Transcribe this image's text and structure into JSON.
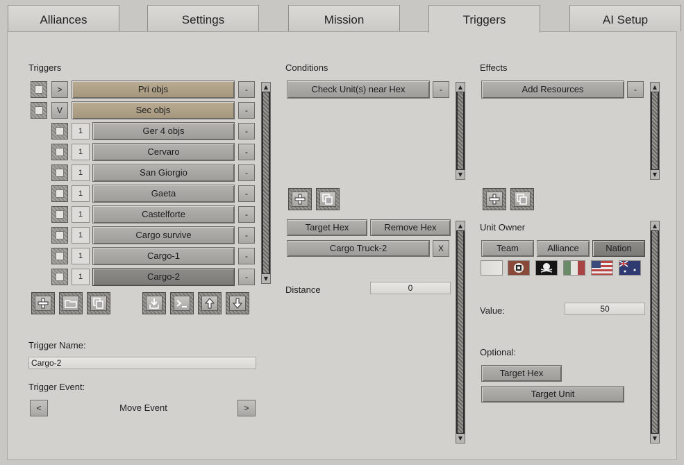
{
  "tabs": [
    "Alliances",
    "Settings",
    "Mission",
    "Triggers",
    "AI Setup"
  ],
  "triggers": {
    "label": "Triggers",
    "rows": [
      {
        "toggle": ">",
        "name": "Pri objs",
        "remove": "-"
      },
      {
        "toggle": "V",
        "name": "Sec objs",
        "remove": "-"
      },
      {
        "num": "1",
        "name": "Ger 4 objs",
        "remove": "-"
      },
      {
        "num": "1",
        "name": "Cervaro",
        "remove": "-"
      },
      {
        "num": "1",
        "name": "San Giorgio",
        "remove": "-"
      },
      {
        "num": "1",
        "name": "Gaeta",
        "remove": "-"
      },
      {
        "num": "1",
        "name": "Castelforte",
        "remove": "-"
      },
      {
        "num": "1",
        "name": "Cargo survive",
        "remove": "-"
      },
      {
        "num": "1",
        "name": "Cargo-1",
        "remove": "-"
      },
      {
        "num": "1",
        "name": "Cargo-2",
        "remove": "-"
      }
    ],
    "name_label": "Trigger Name:",
    "name_value": "Cargo-2",
    "event_label": "Trigger Event:",
    "event_prev": "<",
    "event_value": "Move Event",
    "event_next": ">"
  },
  "conditions": {
    "label": "Conditions",
    "items": [
      {
        "name": "Check Unit(s) near Hex",
        "remove": "-"
      }
    ],
    "target_hex": "Target Hex",
    "remove_hex": "Remove Hex",
    "unit": "Cargo Truck-2",
    "unit_remove": "X",
    "distance_label": "Distance",
    "distance_value": "0"
  },
  "effects": {
    "label": "Effects",
    "items": [
      {
        "name": "Add Resources",
        "remove": "-"
      }
    ],
    "unit_owner_label": "Unit Owner",
    "owner_buttons": [
      "Team",
      "Alliance",
      "Nation"
    ],
    "selected_owner": "Nation",
    "value_label": "Value:",
    "value": "50",
    "optional_label": "Optional:",
    "target_hex": "Target Hex",
    "target_unit": "Target Unit"
  },
  "flags": [
    "empty-flag-icon",
    "german-flag-icon",
    "pirate-flag-icon",
    "italian-flag-icon",
    "usa-flag-icon",
    "australia-flag-icon"
  ]
}
